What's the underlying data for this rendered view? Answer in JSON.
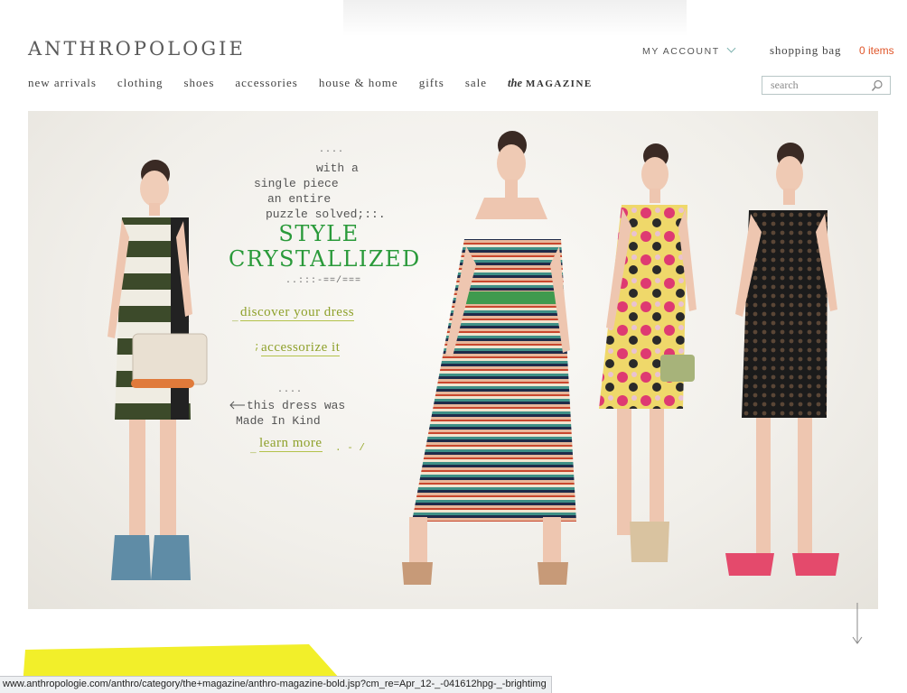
{
  "brand": {
    "logo_text": "ANTHROPOLOGIE"
  },
  "header": {
    "account_label": "MY ACCOUNT",
    "bag_label": "shopping bag",
    "bag_count": "0 items"
  },
  "nav": {
    "items": [
      {
        "label": "new arrivals"
      },
      {
        "label": "clothing"
      },
      {
        "label": "shoes"
      },
      {
        "label": "accessories"
      },
      {
        "label": "house & home"
      },
      {
        "label": "gifts"
      },
      {
        "label": "sale"
      }
    ],
    "magazine_prefix": "the",
    "magazine_label": "MAGAZINE"
  },
  "search": {
    "placeholder": "search",
    "icon": "magnifier-icon"
  },
  "hero": {
    "intro_dots": "....",
    "intro_lines": [
      "with a",
      "single piece",
      "an entire",
      "puzzle solved;::."
    ],
    "headline_line1": "STYLE",
    "headline_line2": "CRYSTALLIZED",
    "divider_dots": "..:::-==/===",
    "cta_primary": "discover your dress",
    "cta_secondary": "accessorize it",
    "made_dots": "....",
    "made_line1": "this dress was",
    "made_line2": "Made In Kind",
    "cta_learn": "learn more",
    "colors": {
      "headline": "#2a9a3a",
      "cta": "#8fa12c"
    }
  },
  "status_bar": {
    "url": "www.anthropologie.com/anthro/category/the+magazine/anthro-magazine-bold.jsp?cm_re=Apr_12-_-041612hpg-_-brightimg"
  },
  "colors": {
    "accent_orange": "#e0562a",
    "chevron_teal": "#7fb3b0",
    "yellow_band": "#f2ef2a"
  }
}
